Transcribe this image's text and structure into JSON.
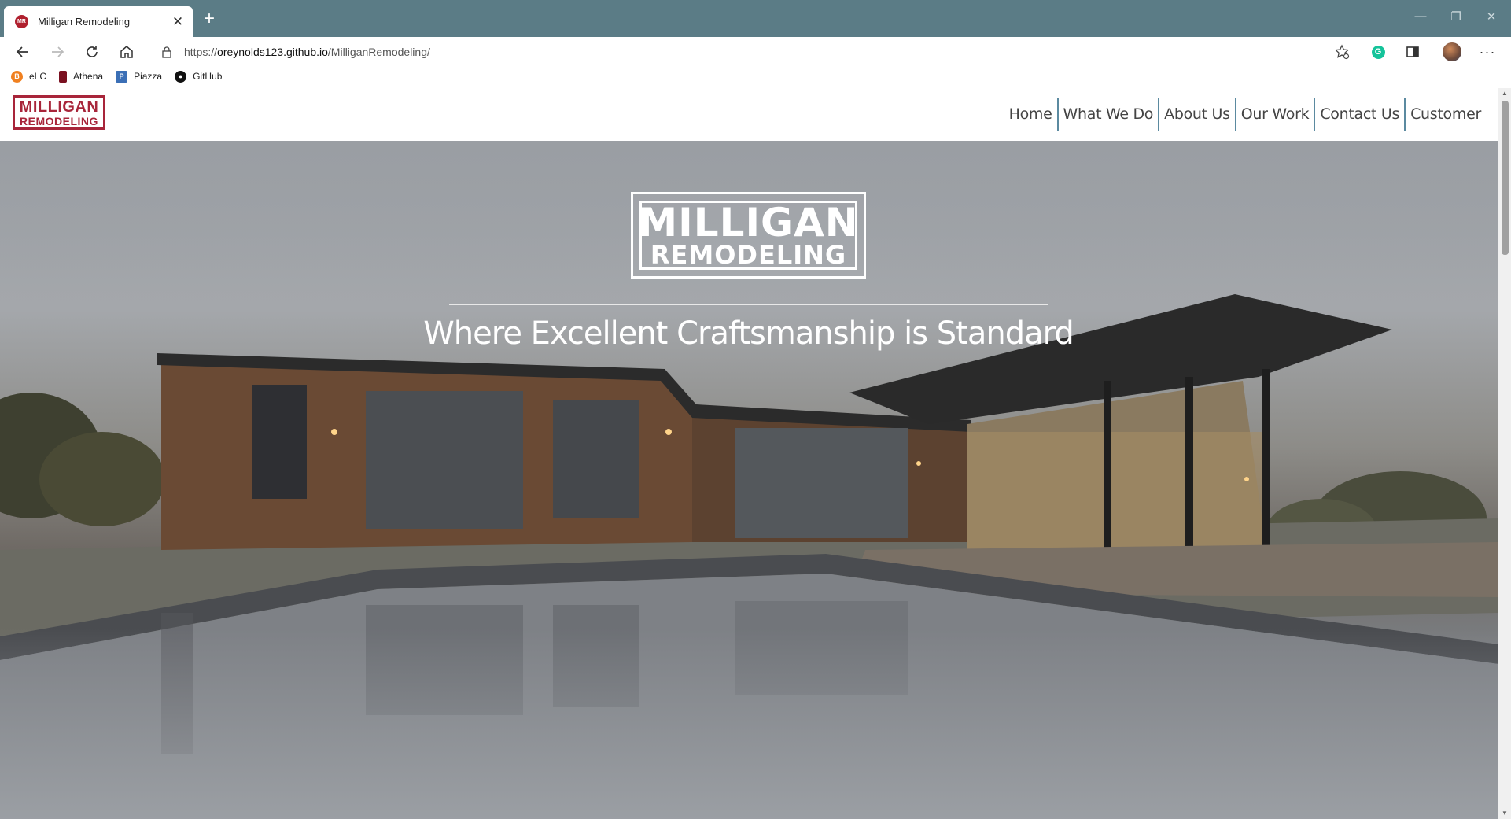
{
  "browser": {
    "tab_title": "Milligan Remodeling",
    "tab_favicon_text": "MR",
    "url_scheme": "https://",
    "url_host": "oreynolds123.github.io",
    "url_path": "/MilliganRemodeling/",
    "bookmarks": [
      {
        "label": "eLC",
        "icon": "elc-icon",
        "color": "#f08020"
      },
      {
        "label": "Athena",
        "icon": "athena-icon",
        "color": "#7a1020"
      },
      {
        "label": "Piazza",
        "icon": "piazza-icon",
        "color": "#3b6fb6"
      },
      {
        "label": "GitHub",
        "icon": "github-icon",
        "color": "#111111"
      }
    ]
  },
  "site": {
    "logo_line1": "MILLIGAN",
    "logo_line2": "REMODELING",
    "nav": [
      "Home",
      "What We Do",
      "About Us",
      "Our Work",
      "Contact Us",
      "Customer"
    ],
    "hero_logo_line1": "MILLIGAN",
    "hero_logo_line2": "REMODELING",
    "tagline": "Where Excellent Craftsmanship is Standard",
    "brand_color": "#a8253a",
    "nav_separator_color": "#5b8aa0"
  }
}
